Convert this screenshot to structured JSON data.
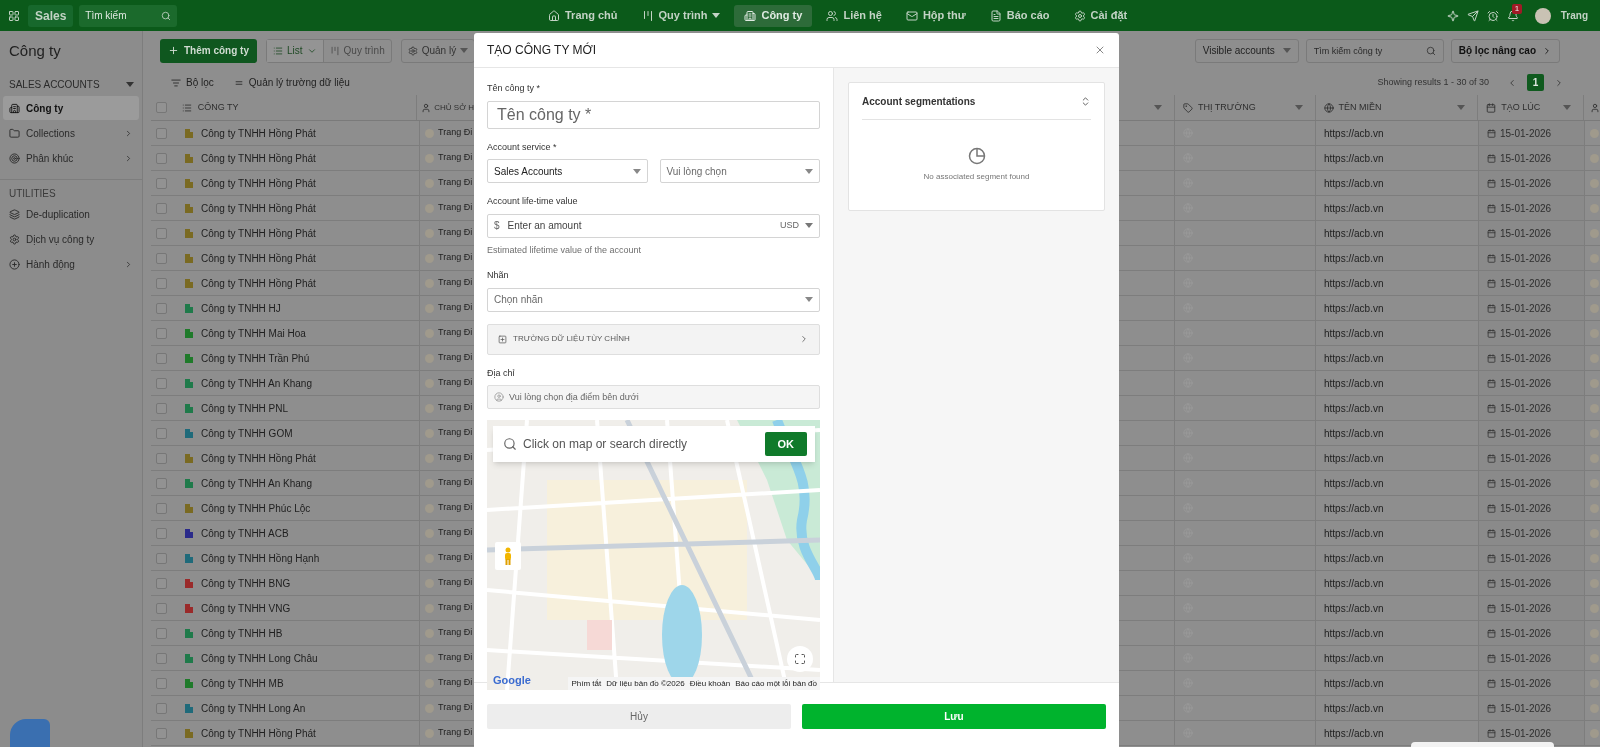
{
  "top_bar": {
    "app_name": "Sales",
    "search_placeholder": "Tìm kiếm",
    "nav": [
      {
        "label": "Trang chủ",
        "selected": false,
        "dropdown": false
      },
      {
        "label": "Quy trình",
        "selected": false,
        "dropdown": true
      },
      {
        "label": "Công ty",
        "selected": true,
        "dropdown": false
      },
      {
        "label": "Liên hệ",
        "selected": false,
        "dropdown": false
      },
      {
        "label": "Hộp thư",
        "selected": false,
        "dropdown": false
      },
      {
        "label": "Báo cáo",
        "selected": false,
        "dropdown": false
      },
      {
        "label": "Cài đặt",
        "selected": false,
        "dropdown": false
      }
    ],
    "notification_count": "1",
    "user_name": "Trang"
  },
  "sidebar": {
    "title": "Công ty",
    "section": "SALES ACCOUNTS",
    "items": [
      {
        "label": "Công ty",
        "selected": true,
        "submenu": false
      },
      {
        "label": "Collections",
        "selected": false,
        "submenu": true
      },
      {
        "label": "Phân khúc",
        "selected": false,
        "submenu": true
      }
    ],
    "utilities_title": "UTILITIES",
    "utilities": [
      {
        "label": "De-duplication",
        "submenu": false
      },
      {
        "label": "Dịch vụ công ty",
        "submenu": false
      },
      {
        "label": "Hành động",
        "submenu": true
      }
    ]
  },
  "toolbar": {
    "add_button": "Thêm công ty",
    "views": [
      {
        "label": "List",
        "selected": true
      },
      {
        "label": "Quy trình",
        "selected": false
      }
    ],
    "manage": "Quản lý",
    "visible_filter": "Visible accounts",
    "search_placeholder": "Tìm kiếm công ty",
    "advanced_filter": "Bộ lọc nâng cao",
    "filter": "Bộ lọc",
    "manage_fields": "Quản lý trường dữ liệu",
    "results": "Showing results 1 - 30 of 30",
    "pages": [
      {
        "label": "1",
        "selected": true
      }
    ]
  },
  "table": {
    "select_all_checked": false,
    "columns_left": [
      "CÔNG TY",
      "CHỦ SỞ H"
    ],
    "columns_right": [
      "THỊ TRƯỜNG",
      "TÊN MIỀN",
      "TẠO LÚC"
    ],
    "rows": [
      {
        "name": "Công ty TNHH Hồng Phát",
        "color": "#7a6a22",
        "owner": "Trang Đi",
        "domain": "https://acb.vn",
        "created": "15-01-2026",
        "checked": false
      },
      {
        "name": "Công ty TNHH Hồng Phát",
        "color": "#7a6a22",
        "owner": "Trang Đi",
        "domain": "https://acb.vn",
        "created": "15-01-2026",
        "checked": false
      },
      {
        "name": "Công ty TNHH Hồng Phát",
        "color": "#7a6a22",
        "owner": "Trang Đi",
        "domain": "https://acb.vn",
        "created": "15-01-2026",
        "checked": false
      },
      {
        "name": "Công ty TNHH Hồng Phát",
        "color": "#7a6a22",
        "owner": "Trang Đi",
        "domain": "https://acb.vn",
        "created": "15-01-2026",
        "checked": false
      },
      {
        "name": "Công ty TNHH Hồng Phát",
        "color": "#7a6a22",
        "owner": "Trang Đi",
        "domain": "https://acb.vn",
        "created": "15-01-2026",
        "checked": false
      },
      {
        "name": "Công ty TNHH Hồng Phát",
        "color": "#7a6a22",
        "owner": "Trang Đi",
        "domain": "https://acb.vn",
        "created": "15-01-2026",
        "checked": false
      },
      {
        "name": "Công ty TNHH Hồng Phát",
        "color": "#7a6a22",
        "owner": "Trang Đi",
        "domain": "https://acb.vn",
        "created": "15-01-2026",
        "checked": false
      },
      {
        "name": "Công ty TNHH HJ",
        "color": "#1f7a4a",
        "owner": "Trang Đi",
        "domain": "https://acb.vn",
        "created": "15-01-2026",
        "checked": false
      },
      {
        "name": "Công ty TNHH Mai Hoa",
        "color": "#1f7a2a",
        "owner": "Trang Đi",
        "domain": "https://acb.vn",
        "created": "15-01-2026",
        "checked": false
      },
      {
        "name": "Công ty TNHH Trần Phú",
        "color": "#1f7a2a",
        "owner": "Trang Đi",
        "domain": "https://acb.vn",
        "created": "15-01-2026",
        "checked": false
      },
      {
        "name": "Công ty TNHH An Khang",
        "color": "#1f7a4a",
        "owner": "Trang Đi",
        "domain": "https://acb.vn",
        "created": "15-01-2026",
        "checked": false
      },
      {
        "name": "Công ty TNHH PNL",
        "color": "#1f7a4a",
        "owner": "Trang Đi",
        "domain": "https://acb.vn",
        "created": "15-01-2026",
        "checked": false
      },
      {
        "name": "Công ty TNHH GOM",
        "color": "#1f6a7a",
        "owner": "Trang Đi",
        "domain": "https://acb.vn",
        "created": "15-01-2026",
        "checked": false
      },
      {
        "name": "Công ty TNHH Hồng Phát",
        "color": "#7a6a22",
        "owner": "Trang Đi",
        "domain": "https://acb.vn",
        "created": "15-01-2026",
        "checked": false
      },
      {
        "name": "Công ty TNHH An Khang",
        "color": "#1f7a4a",
        "owner": "Trang Đi",
        "domain": "https://acb.vn",
        "created": "15-01-2026",
        "checked": false
      },
      {
        "name": "Công ty TNHH Phúc Lộc",
        "color": "#7a6a22",
        "owner": "Trang Đi",
        "domain": "https://acb.vn",
        "created": "15-01-2026",
        "checked": false
      },
      {
        "name": "Công ty TNHH ACB",
        "color": "#2a2a8a",
        "owner": "Trang Đi",
        "domain": "https://acb.vn",
        "created": "15-01-2026",
        "checked": false
      },
      {
        "name": "Công ty TNHH Hồng Hạnh",
        "color": "#1f6a7a",
        "owner": "Trang Đi",
        "domain": "https://acb.vn",
        "created": "15-01-2026",
        "checked": false
      },
      {
        "name": "Công ty TNHH BNG",
        "color": "#9a2a2a",
        "owner": "Trang Đi",
        "domain": "https://acb.vn",
        "created": "15-01-2026",
        "checked": false
      },
      {
        "name": "Công ty TNHH VNG",
        "color": "#9a2a2a",
        "owner": "Trang Đi",
        "domain": "https://acb.vn",
        "created": "15-01-2026",
        "checked": false
      },
      {
        "name": "Công ty TNHH HB",
        "color": "#1f7a4a",
        "owner": "Trang Đi",
        "domain": "https://acb.vn",
        "created": "15-01-2026",
        "checked": false
      },
      {
        "name": "Công ty TNHH Long Châu",
        "color": "#1f7a4a",
        "owner": "Trang Đi",
        "domain": "https://acb.vn",
        "created": "15-01-2026",
        "checked": false
      },
      {
        "name": "Công ty TNHH MB",
        "color": "#1f7a2a",
        "owner": "Trang Đi",
        "domain": "https://acb.vn",
        "created": "15-01-2026",
        "checked": false
      },
      {
        "name": "Công ty TNHH Long An",
        "color": "#1f6a7a",
        "owner": "Trang Đi",
        "domain": "https://acb.vn",
        "created": "15-01-2026",
        "checked": false
      },
      {
        "name": "Công ty TNHH Hồng Phát",
        "color": "#7a6a22",
        "owner": "Trang Đi",
        "domain": "https://acb.vn",
        "created": "15-01-2026",
        "checked": false
      }
    ]
  },
  "modal": {
    "title": "TẠO CÔNG TY MỚI",
    "fields": [
      {
        "kind": "text",
        "label": "Tên công ty *",
        "placeholder": "Tên công ty *"
      },
      {
        "kind": "select_pair",
        "label": "Account service *",
        "selects": [
          {
            "value": "Sales Accounts"
          },
          {
            "placeholder": "Vui lòng chọn"
          }
        ]
      },
      {
        "kind": "amount",
        "label": "Account life-time value",
        "prefix": "$",
        "placeholder": "Enter an amount",
        "currency": "USD",
        "hint": "Estimated lifetime value of the account"
      },
      {
        "kind": "select",
        "label": "Nhãn",
        "placeholder": "Chọn nhãn"
      },
      {
        "kind": "section",
        "label": "TRƯỜNG DỮ LIỆU TÙY CHỈNH",
        "expanded": false
      },
      {
        "kind": "address",
        "label": "Địa chỉ",
        "placeholder": "Vui lòng chọn địa điểm bên dưới"
      }
    ],
    "map": {
      "search_placeholder": "Click on map or search directly",
      "ok_button": "OK",
      "logo": "Google",
      "attribution": [
        "Phím tắt",
        "Dữ liệu bản đồ ©2026",
        "Điều khoản",
        "Báo cáo một lỗi bản đồ"
      ]
    },
    "segments": {
      "title": "Account segmentations",
      "empty": "No associated segment found"
    },
    "buttons": {
      "cancel": "Hủy",
      "save": "Lưu"
    }
  }
}
